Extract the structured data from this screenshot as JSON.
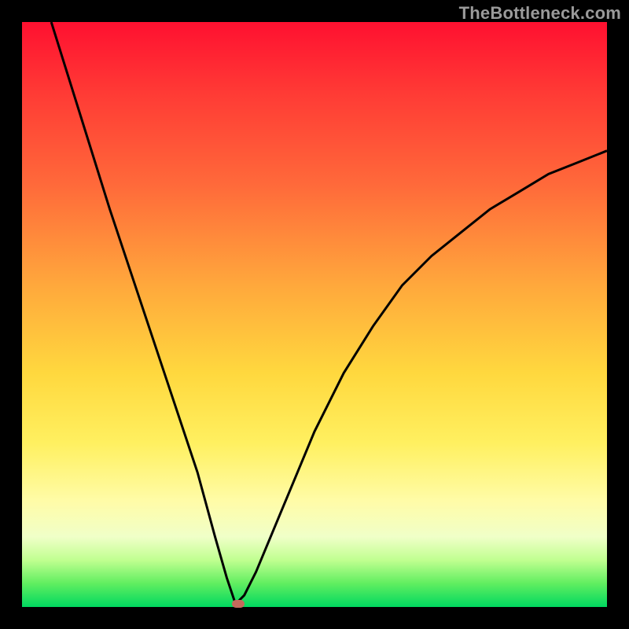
{
  "watermark": "TheBottleneck.com",
  "chart_data": {
    "type": "line",
    "title": "",
    "xlabel": "",
    "ylabel": "",
    "xlim": [
      0,
      100
    ],
    "ylim": [
      0,
      100
    ],
    "grid": false,
    "legend": false,
    "annotations": [],
    "series": [
      {
        "name": "bottleneck-curve",
        "x": [
          5,
          10,
          15,
          20,
          25,
          30,
          33,
          35,
          36.5,
          38,
          40,
          45,
          50,
          55,
          60,
          65,
          70,
          75,
          80,
          85,
          90,
          95,
          100
        ],
        "values": [
          100,
          84,
          68,
          53,
          38,
          23,
          12,
          5,
          0.5,
          2,
          6,
          18,
          30,
          40,
          48,
          55,
          60,
          64,
          68,
          71,
          74,
          76,
          78
        ]
      }
    ],
    "marker": {
      "x": 37,
      "y": 0.5
    },
    "colors": {
      "curve": "#000000",
      "marker": "#c56a5c",
      "gradient_top": "#ff1030",
      "gradient_bottom": "#00d860",
      "frame": "#000000"
    }
  }
}
